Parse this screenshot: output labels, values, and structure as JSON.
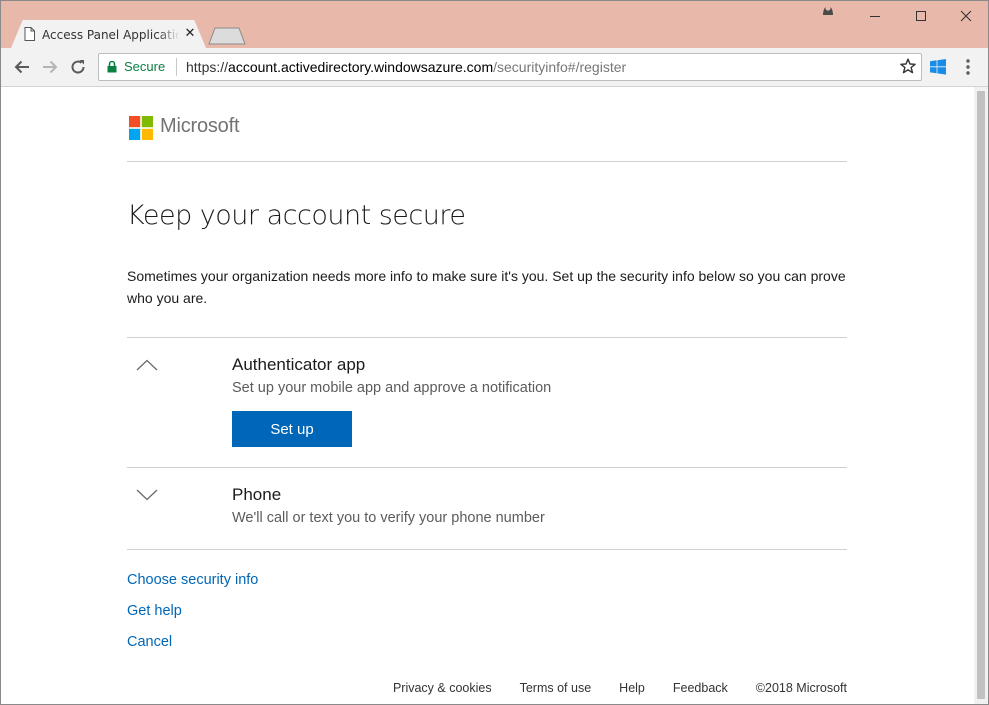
{
  "browser": {
    "tab_title": "Access Panel Applications",
    "tab_close": "✕",
    "secure_label": "Secure",
    "url_scheme": "https://",
    "url_host": "account.activedirectory.windowsazure.com",
    "url_path": "/securityinfo#/register"
  },
  "brand": {
    "name": "Microsoft"
  },
  "page": {
    "title": "Keep your account secure",
    "intro": "Sometimes your organization needs more info to make sure it's you. Set up the security info below so you can prove who you are."
  },
  "methods": [
    {
      "name": "Authenticator app",
      "description": "Set up your mobile app and approve a notification",
      "button": "Set up",
      "expanded": true
    },
    {
      "name": "Phone",
      "description": "We'll call or text you to verify your phone number",
      "expanded": false
    }
  ],
  "links": {
    "choose": "Choose security info",
    "help": "Get help",
    "cancel": "Cancel"
  },
  "footer": {
    "privacy": "Privacy & cookies",
    "terms": "Terms of use",
    "help": "Help",
    "feedback": "Feedback",
    "copyright": "©2018 Microsoft"
  },
  "colors": {
    "accent": "#0067b8",
    "titlebar": "#e8b9ab",
    "secure": "#0b8043",
    "logo_red": "#f25022",
    "logo_green": "#7fba00",
    "logo_blue": "#00a4ef",
    "logo_yellow": "#ffb900"
  },
  "icons": [
    "page-icon",
    "close-icon",
    "new-tab-icon",
    "profile-icon",
    "minimize-icon",
    "maximize-icon",
    "window-close-icon",
    "back-arrow-icon",
    "forward-arrow-icon",
    "reload-icon",
    "lock-icon",
    "star-icon",
    "windows-logo-icon",
    "menu-dots-icon",
    "chevron-up-icon",
    "chevron-down-icon",
    "microsoft-logo-icon"
  ]
}
